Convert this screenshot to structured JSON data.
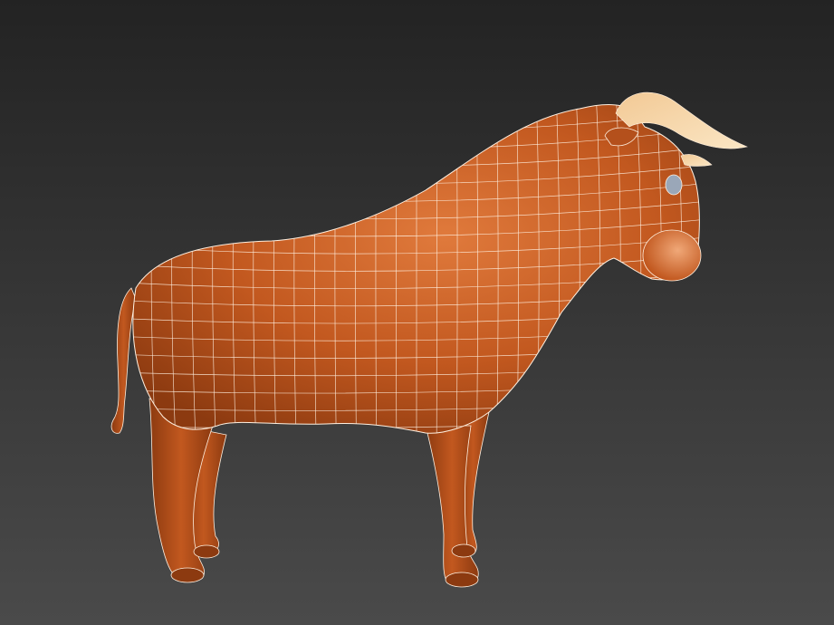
{
  "viewport": {
    "background_top": "#232323",
    "background_bottom": "#4a4a4a"
  },
  "model": {
    "subject": "bull",
    "body_color": "#c2581f",
    "body_highlight": "#e07a3c",
    "body_shadow": "#8c3a10",
    "horn_color": "#f2c995",
    "horn_tip": "#fbe6c4",
    "wireframe_color": "#fff0e0",
    "eye_color": "#9aa7b8"
  }
}
